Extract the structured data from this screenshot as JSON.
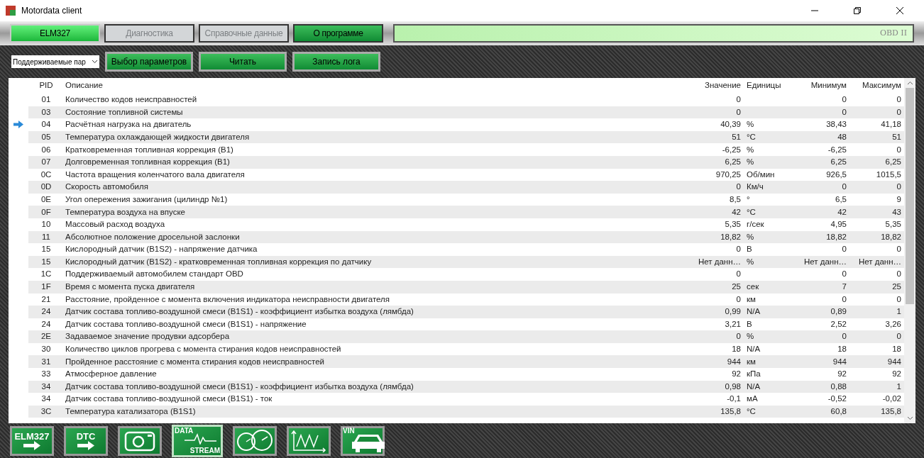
{
  "window": {
    "title": "Motordata client"
  },
  "tabs": [
    {
      "label": "ELM327",
      "selected": true,
      "disabled": false
    },
    {
      "label": "Диагностика",
      "selected": false,
      "disabled": true
    },
    {
      "label": "Справочные данные",
      "selected": false,
      "disabled": true
    },
    {
      "label": "О программе",
      "selected": false,
      "disabled": false
    }
  ],
  "protocol": "OBD II",
  "toolbar": {
    "dropdown": {
      "value": "Поддерживаемые пар"
    },
    "buttons": [
      "Выбор параметров",
      "Читать",
      "Запись лога"
    ]
  },
  "table": {
    "columns": [
      "PID",
      "Описание",
      "Значение",
      "Единицы",
      "Минимум",
      "Максимум"
    ],
    "rows": [
      {
        "pid": "01",
        "description": "Количество кодов неисправностей",
        "value": "0",
        "unit": "",
        "min": "0",
        "max": "0",
        "current": false
      },
      {
        "pid": "03",
        "description": "Состояние топливной системы",
        "value": "0",
        "unit": "",
        "min": "0",
        "max": "0",
        "current": false
      },
      {
        "pid": "04",
        "description": "Расчётная нагрузка на двигатель",
        "value": "40,39",
        "unit": "%",
        "min": "38,43",
        "max": "41,18",
        "current": true
      },
      {
        "pid": "05",
        "description": "Температура охлаждающей жидкости двигателя",
        "value": "51",
        "unit": "°C",
        "min": "48",
        "max": "51",
        "current": false
      },
      {
        "pid": "06",
        "description": "Кратковременная топливная коррекция (B1)",
        "value": "-6,25",
        "unit": "%",
        "min": "-6,25",
        "max": "0",
        "current": false
      },
      {
        "pid": "07",
        "description": "Долговременная топливная коррекция (B1)",
        "value": "6,25",
        "unit": "%",
        "min": "6,25",
        "max": "6,25",
        "current": false
      },
      {
        "pid": "0C",
        "description": "Частота вращения коленчатого вала двигателя",
        "value": "970,25",
        "unit": "Об/мин",
        "min": "926,5",
        "max": "1015,5",
        "current": false
      },
      {
        "pid": "0D",
        "description": "Скорость автомобиля",
        "value": "0",
        "unit": "Км/ч",
        "min": "0",
        "max": "0",
        "current": false
      },
      {
        "pid": "0E",
        "description": "Угол опережения зажигания (цилиндр №1)",
        "value": "8,5",
        "unit": "°",
        "min": "6,5",
        "max": "9",
        "current": false
      },
      {
        "pid": "0F",
        "description": "Температура воздуха на впуске",
        "value": "42",
        "unit": "°C",
        "min": "42",
        "max": "43",
        "current": false
      },
      {
        "pid": "10",
        "description": "Массовый расход воздуха",
        "value": "5,35",
        "unit": "г/сек",
        "min": "4,95",
        "max": "5,35",
        "current": false
      },
      {
        "pid": "11",
        "description": "Абсолютное положение дросельной заслонки",
        "value": "18,82",
        "unit": "%",
        "min": "18,82",
        "max": "18,82",
        "current": false
      },
      {
        "pid": "15",
        "description": "Кислородный датчик (B1S2) - напряжение датчика",
        "value": "0",
        "unit": "В",
        "min": "0",
        "max": "0",
        "current": false
      },
      {
        "pid": "15",
        "description": "Кислородный датчик (B1S2) - кратковременная топливная коррекция по датчику",
        "value": "Нет данн…",
        "unit": "%",
        "min": "Нет данн…",
        "max": "Нет данн…",
        "current": false
      },
      {
        "pid": "1C",
        "description": "Поддерживаемый автомобилем стандарт OBD",
        "value": "0",
        "unit": "",
        "min": "0",
        "max": "0",
        "current": false
      },
      {
        "pid": "1F",
        "description": "Время с момента пуска двигателя",
        "value": "25",
        "unit": "сек",
        "min": "7",
        "max": "25",
        "current": false
      },
      {
        "pid": "21",
        "description": "Расстояние, пройденное с момента включения индикатора неисправности двигателя",
        "value": "0",
        "unit": "км",
        "min": "0",
        "max": "0",
        "current": false
      },
      {
        "pid": "24",
        "description": "Датчик состава топливо-воздушной смеси (B1S1) - коэффициент избытка воздуха (лямбда)",
        "value": "0,99",
        "unit": "N/A",
        "min": "0,89",
        "max": "1",
        "current": false
      },
      {
        "pid": "24",
        "description": "Датчик состава топливо-воздушной смеси (B1S1) - напряжение",
        "value": "3,21",
        "unit": "В",
        "min": "2,52",
        "max": "3,26",
        "current": false
      },
      {
        "pid": "2E",
        "description": "Задаваемое значение продувки адсорбера",
        "value": "0",
        "unit": "%",
        "min": "0",
        "max": "0",
        "current": false
      },
      {
        "pid": "30",
        "description": "Количество циклов прогрева с момента стирания кодов неисправностей",
        "value": "18",
        "unit": "N/A",
        "min": "18",
        "max": "18",
        "current": false
      },
      {
        "pid": "31",
        "description": "Пройденное расстояние с момента стирания кодов неисправностей",
        "value": "944",
        "unit": "км",
        "min": "944",
        "max": "944",
        "current": false
      },
      {
        "pid": "33",
        "description": "Атмосферное давление",
        "value": "92",
        "unit": "кПа",
        "min": "92",
        "max": "92",
        "current": false
      },
      {
        "pid": "34",
        "description": "Датчик состава топливо-воздушной смеси (B1S1) - коэффициент избытка воздуха (лямбда)",
        "value": "0,98",
        "unit": "N/A",
        "min": "0,88",
        "max": "1",
        "current": false
      },
      {
        "pid": "34",
        "description": "Датчик состава топливо-воздушной смеси (B1S1) - ток",
        "value": "-0,1",
        "unit": "мА",
        "min": "-0,52",
        "max": "-0,02",
        "current": false
      },
      {
        "pid": "3C",
        "description": "Температура катализатора (B1S1)",
        "value": "135,8",
        "unit": "°C",
        "min": "60,8",
        "max": "135,8",
        "current": false
      }
    ]
  },
  "bottom_bar": [
    {
      "kind": "elm327",
      "labels": [
        "ELM327"
      ],
      "selected": false
    },
    {
      "kind": "dtc",
      "labels": [
        "DTC"
      ],
      "selected": false
    },
    {
      "kind": "camera",
      "selected": false
    },
    {
      "kind": "stream",
      "labels": [
        "DATA",
        "STREAM"
      ],
      "selected": true
    },
    {
      "kind": "gauges",
      "selected": false
    },
    {
      "kind": "graph",
      "selected": false
    },
    {
      "kind": "vin",
      "labels": [
        "VIN"
      ],
      "selected": false
    }
  ]
}
